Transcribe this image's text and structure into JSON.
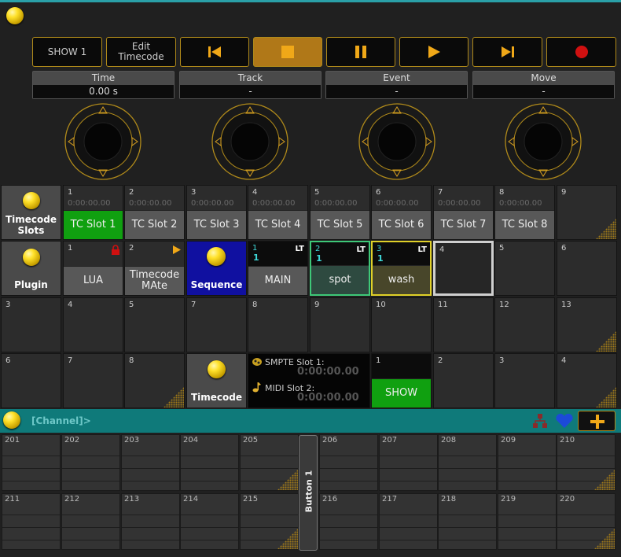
{
  "colors": {
    "accent": "#b08a1a",
    "active_green": "#10a010",
    "sequence_blue": "#1010a0",
    "cmdline": "#0f7a7a"
  },
  "transport": {
    "show_label": "SHOW 1",
    "edit_label": "Edit Timecode",
    "icons": [
      "skip-back-icon",
      "stop-icon",
      "pause-icon",
      "play-icon",
      "skip-forward-icon",
      "record-icon"
    ]
  },
  "fields": [
    {
      "label": "Time",
      "value": "0.00 s"
    },
    {
      "label": "Track",
      "value": "-"
    },
    {
      "label": "Event",
      "value": "-"
    },
    {
      "label": "Move",
      "value": "-"
    }
  ],
  "row1": {
    "header": "Timecode Slots",
    "slots": [
      {
        "num": "1",
        "tc": "0:00:00.00",
        "label": "TC Slot 1",
        "active": true
      },
      {
        "num": "2",
        "tc": "0:00:00.00",
        "label": "TC Slot 2"
      },
      {
        "num": "3",
        "tc": "0:00:00.00",
        "label": "TC Slot 3"
      },
      {
        "num": "4",
        "tc": "0:00:00.00",
        "label": "TC Slot 4"
      },
      {
        "num": "5",
        "tc": "0:00:00.00",
        "label": "TC Slot 5"
      },
      {
        "num": "6",
        "tc": "0:00:00.00",
        "label": "TC Slot 6"
      },
      {
        "num": "7",
        "tc": "0:00:00.00",
        "label": "TC Slot 7"
      },
      {
        "num": "8",
        "tc": "0:00:00.00",
        "label": "TC Slot 8"
      }
    ],
    "empty": "9"
  },
  "row2": {
    "header": "Plugin",
    "lua": {
      "num": "1",
      "label": "LUA"
    },
    "tmate": {
      "num": "2",
      "label": "TimecodeMAte"
    },
    "sequence": "Sequence",
    "seqs": [
      {
        "num": "1",
        "sub": "1",
        "badge": "LT",
        "label": "MAIN"
      },
      {
        "num": "2",
        "sub": "1",
        "badge": "LT",
        "label": "spot"
      },
      {
        "num": "3",
        "sub": "1",
        "badge": "LT",
        "label": "wash"
      }
    ],
    "empties": [
      "4",
      "5",
      "6"
    ]
  },
  "row3": [
    "3",
    "4",
    "5",
    "7",
    "8",
    "9",
    "10",
    "11",
    "12",
    "13"
  ],
  "row4": {
    "nums": [
      "6",
      "7",
      "8"
    ],
    "header": "Timecode",
    "smpte_label": "SMPTE Slot 1:",
    "smpte_value": "0:00:00.00",
    "midi_label": "MIDI Slot 2:",
    "midi_value": "0:00:00.00",
    "show_num": "1",
    "show_label": "SHOW",
    "empties": [
      "2",
      "3",
      "4"
    ]
  },
  "cmdline": {
    "prompt": "[Channel]>"
  },
  "faders_top": [
    "201",
    "202",
    "203",
    "204",
    "205",
    "206",
    "207",
    "208",
    "209",
    "210"
  ],
  "faders_bottom": [
    "211",
    "212",
    "213",
    "214",
    "215",
    "216",
    "217",
    "218",
    "219",
    "220"
  ],
  "button1": "Button 1"
}
